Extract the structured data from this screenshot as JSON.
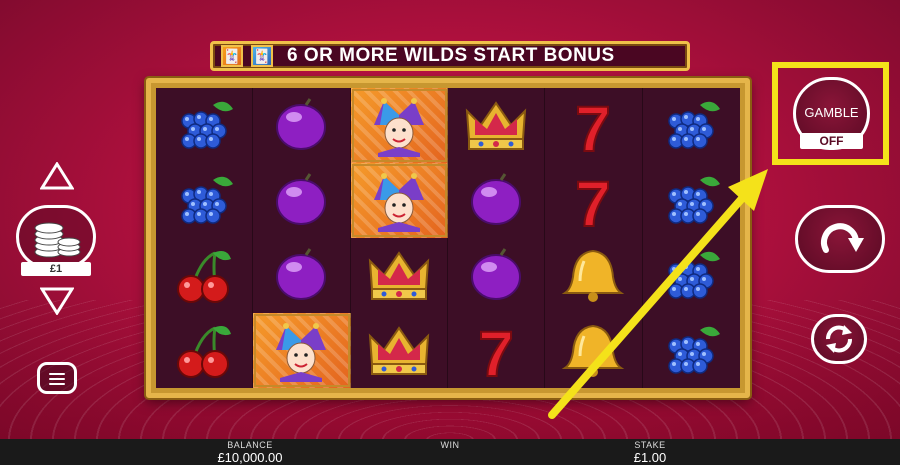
{
  "banner": {
    "text": "6 OR MORE WILDS START BONUS",
    "icons": [
      "jester-wild-icon-orange",
      "jester-wild-icon-blue"
    ]
  },
  "reels": [
    [
      "grapes",
      "plum",
      "jester",
      "crown",
      "seven",
      "grapes"
    ],
    [
      "grapes",
      "plum",
      "jester",
      "plum",
      "seven",
      "grapes"
    ],
    [
      "cherries",
      "plum",
      "crown",
      "plum",
      "bell",
      "grapes"
    ],
    [
      "cherries",
      "jester",
      "crown",
      "seven",
      "bell",
      "grapes"
    ]
  ],
  "stake_selector": {
    "value": "£1",
    "icon": "coin-stack-icon"
  },
  "gamble": {
    "label": "GAMBLE",
    "state": "OFF",
    "highlighted": true,
    "highlight_color": "#f4e21a"
  },
  "controls": {
    "spin_icon": "spin-arrow-icon",
    "autoplay_icon": "autoplay-cycle-icon",
    "menu_icon": "hamburger-menu-icon"
  },
  "bottom_bar": {
    "balance_label": "BALANCE",
    "balance_value": "£10,000.00",
    "win_label": "WIN",
    "win_value": "",
    "stake_label": "STAKE",
    "stake_value": "£1.00"
  },
  "colors": {
    "background": "#b0103e",
    "frame_gold": "#e5b54a",
    "reel_bg": "#3d0e26",
    "arrow_yellow": "#f4e21a"
  }
}
